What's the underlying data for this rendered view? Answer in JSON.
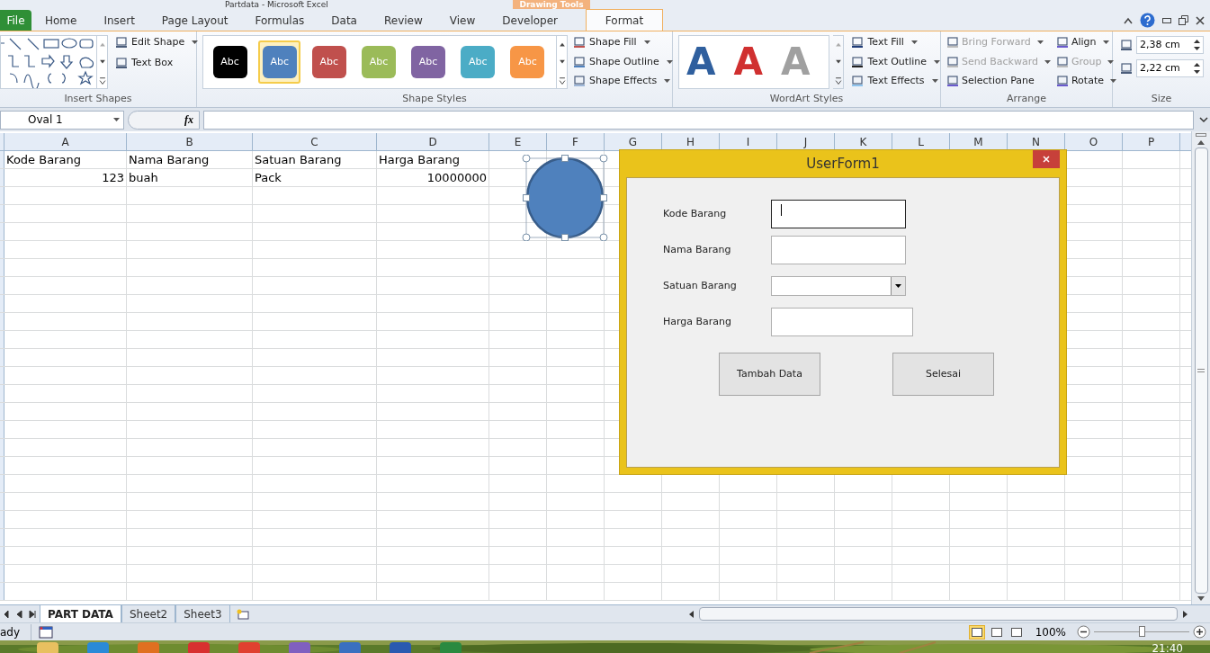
{
  "window": {
    "title": "Partdata - Microsoft Excel",
    "context_group": "Drawing Tools"
  },
  "tabs": [
    {
      "label": "File",
      "kind": "file",
      "selected": false
    },
    {
      "label": "Home",
      "kind": "tab",
      "selected": false
    },
    {
      "label": "Insert",
      "kind": "tab",
      "selected": false
    },
    {
      "label": "Page Layout",
      "kind": "tab",
      "selected": false
    },
    {
      "label": "Formulas",
      "kind": "tab",
      "selected": false
    },
    {
      "label": "Data",
      "kind": "tab",
      "selected": false
    },
    {
      "label": "Review",
      "kind": "tab",
      "selected": false
    },
    {
      "label": "View",
      "kind": "tab",
      "selected": false
    },
    {
      "label": "Developer",
      "kind": "tab",
      "selected": false
    },
    {
      "label": "Format",
      "kind": "context",
      "selected": true
    }
  ],
  "insert_shapes": {
    "label": "Insert Shapes",
    "commands": [
      {
        "label": "Edit Shape",
        "dropdown": true
      },
      {
        "label": "Text Box",
        "dropdown": false
      }
    ]
  },
  "shape_styles": {
    "label": "Shape Styles",
    "swatches": [
      {
        "label": "Abc",
        "color": "#000000",
        "selected": false
      },
      {
        "label": "Abc",
        "color": "#4f81bd",
        "selected": true
      },
      {
        "label": "Abc",
        "color": "#c0504d",
        "selected": false
      },
      {
        "label": "Abc",
        "color": "#9bbb59",
        "selected": false
      },
      {
        "label": "Abc",
        "color": "#8064a2",
        "selected": false
      },
      {
        "label": "Abc",
        "color": "#4bacc6",
        "selected": false
      },
      {
        "label": "Abc",
        "color": "#f79646",
        "selected": false
      }
    ],
    "commands": [
      {
        "label": "Shape Fill",
        "disabled": false
      },
      {
        "label": "Shape Outline",
        "disabled": false
      },
      {
        "label": "Shape Effects",
        "disabled": false
      }
    ]
  },
  "wordart_styles": {
    "label": "WordArt Styles",
    "letters": [
      {
        "label": "A",
        "color": "#2f5f9e"
      },
      {
        "label": "A",
        "color": "#d03030"
      },
      {
        "label": "A",
        "color": "#a0a0a0"
      }
    ],
    "commands": [
      {
        "label": "Text Fill",
        "disabled": false
      },
      {
        "label": "Text Outline",
        "disabled": false
      },
      {
        "label": "Text Effects",
        "disabled": false
      }
    ]
  },
  "arrange": {
    "label": "Arrange",
    "commands": [
      {
        "label": "Bring Forward",
        "disabled": true,
        "dropdown": true
      },
      {
        "label": "Align",
        "disabled": false,
        "dropdown": true
      },
      {
        "label": "Send Backward",
        "disabled": true,
        "dropdown": true
      },
      {
        "label": "Group",
        "disabled": true,
        "dropdown": true
      },
      {
        "label": "Selection Pane",
        "disabled": false,
        "dropdown": false
      },
      {
        "label": "Rotate",
        "disabled": false,
        "dropdown": true
      }
    ]
  },
  "size": {
    "label": "Size",
    "height": "2,38 cm",
    "width": "2,22 cm"
  },
  "name_box": "Oval 1",
  "formula_label": "fx",
  "columns": [
    "A",
    "B",
    "C",
    "D",
    "E",
    "F",
    "G",
    "H",
    "I",
    "J",
    "K",
    "L",
    "M",
    "N",
    "O",
    "P"
  ],
  "rows": [
    {
      "cells": [
        {
          "text": "Kode Barang",
          "kind": "text"
        },
        {
          "text": "Nama Barang",
          "kind": "text"
        },
        {
          "text": "Satuan Barang",
          "kind": "text"
        },
        {
          "text": "Harga Barang",
          "kind": "text"
        }
      ]
    },
    {
      "cells": [
        {
          "text": "123",
          "kind": "number"
        },
        {
          "text": "buah",
          "kind": "text"
        },
        {
          "text": "Pack",
          "kind": "text"
        },
        {
          "text": "10000000",
          "kind": "number"
        }
      ]
    }
  ],
  "userform": {
    "title": "UserForm1",
    "fields": [
      {
        "label": "Kode Barang",
        "kind": "text",
        "focused": true
      },
      {
        "label": "Nama Barang",
        "kind": "text",
        "focused": false
      },
      {
        "label": "Satuan Barang",
        "kind": "combo",
        "focused": false
      },
      {
        "label": "Harga Barang",
        "kind": "text",
        "focused": false
      }
    ],
    "buttons": [
      "Tambah Data",
      "Selesai"
    ]
  },
  "sheet_tabs": [
    {
      "label": "PART DATA",
      "selected": true
    },
    {
      "label": "Sheet2",
      "selected": false
    },
    {
      "label": "Sheet3",
      "selected": false
    }
  ],
  "status": {
    "text": "ady",
    "zoom": "100%",
    "zoom_slider": {
      "level": 0.5
    },
    "views": [
      {
        "selected": true
      },
      {
        "selected": false
      },
      {
        "selected": false
      }
    ]
  },
  "taskbar": {
    "clock": "21:40"
  }
}
